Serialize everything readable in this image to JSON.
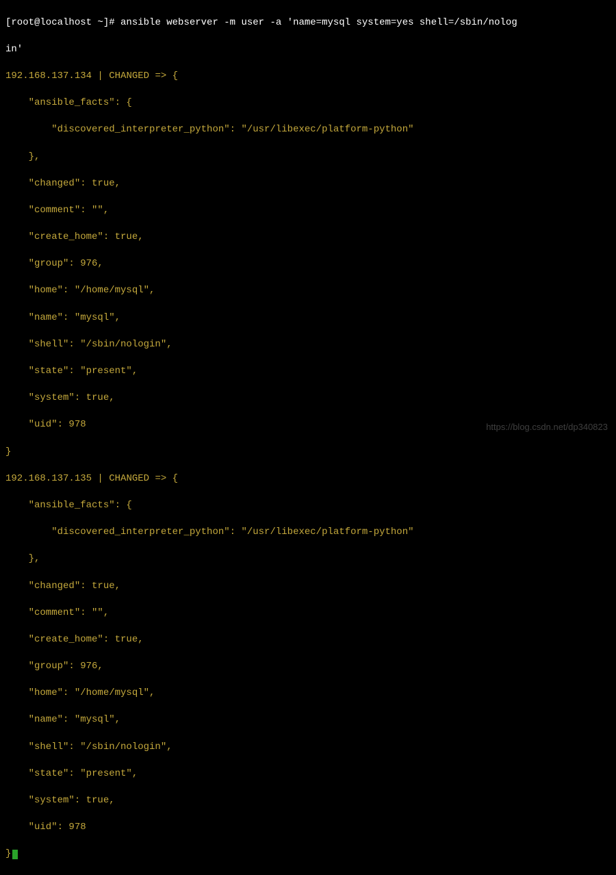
{
  "prompt": {
    "user_host": "[root@localhost ~]# ",
    "command": "ansible webserver -m user -a 'name=mysql system=yes shell=/sbin/nolog",
    "command_continuation": "in'"
  },
  "results": [
    {
      "host": "192.168.137.134",
      "status": "CHANGED",
      "arrow": " => {",
      "facts_key": "    \"ansible_facts\": {",
      "interpreter_line": "        \"discovered_interpreter_python\": \"/usr/libexec/platform-python\"",
      "facts_close": "    },",
      "changed": "    \"changed\": true,",
      "comment": "    \"comment\": \"\",",
      "create_home": "    \"create_home\": true,",
      "group": "    \"group\": 976,",
      "home": "    \"home\": \"/home/mysql\",",
      "name": "    \"name\": \"mysql\",",
      "shell": "    \"shell\": \"/sbin/nologin\",",
      "state": "    \"state\": \"present\",",
      "system": "    \"system\": true,",
      "uid": "    \"uid\": 978",
      "close": "}"
    },
    {
      "host": "192.168.137.135",
      "status": "CHANGED",
      "arrow": " => {",
      "facts_key": "    \"ansible_facts\": {",
      "interpreter_line": "        \"discovered_interpreter_python\": \"/usr/libexec/platform-python\"",
      "facts_close": "    },",
      "changed": "    \"changed\": true,",
      "comment": "    \"comment\": \"\",",
      "create_home": "    \"create_home\": true,",
      "group": "    \"group\": 976,",
      "home": "    \"home\": \"/home/mysql\",",
      "name": "    \"name\": \"mysql\",",
      "shell": "    \"shell\": \"/sbin/nologin\",",
      "state": "    \"state\": \"present\",",
      "system": "    \"system\": true,",
      "uid": "    \"uid\": 978",
      "close": "}"
    }
  ],
  "watermark": "https://blog.csdn.net/dp340823"
}
